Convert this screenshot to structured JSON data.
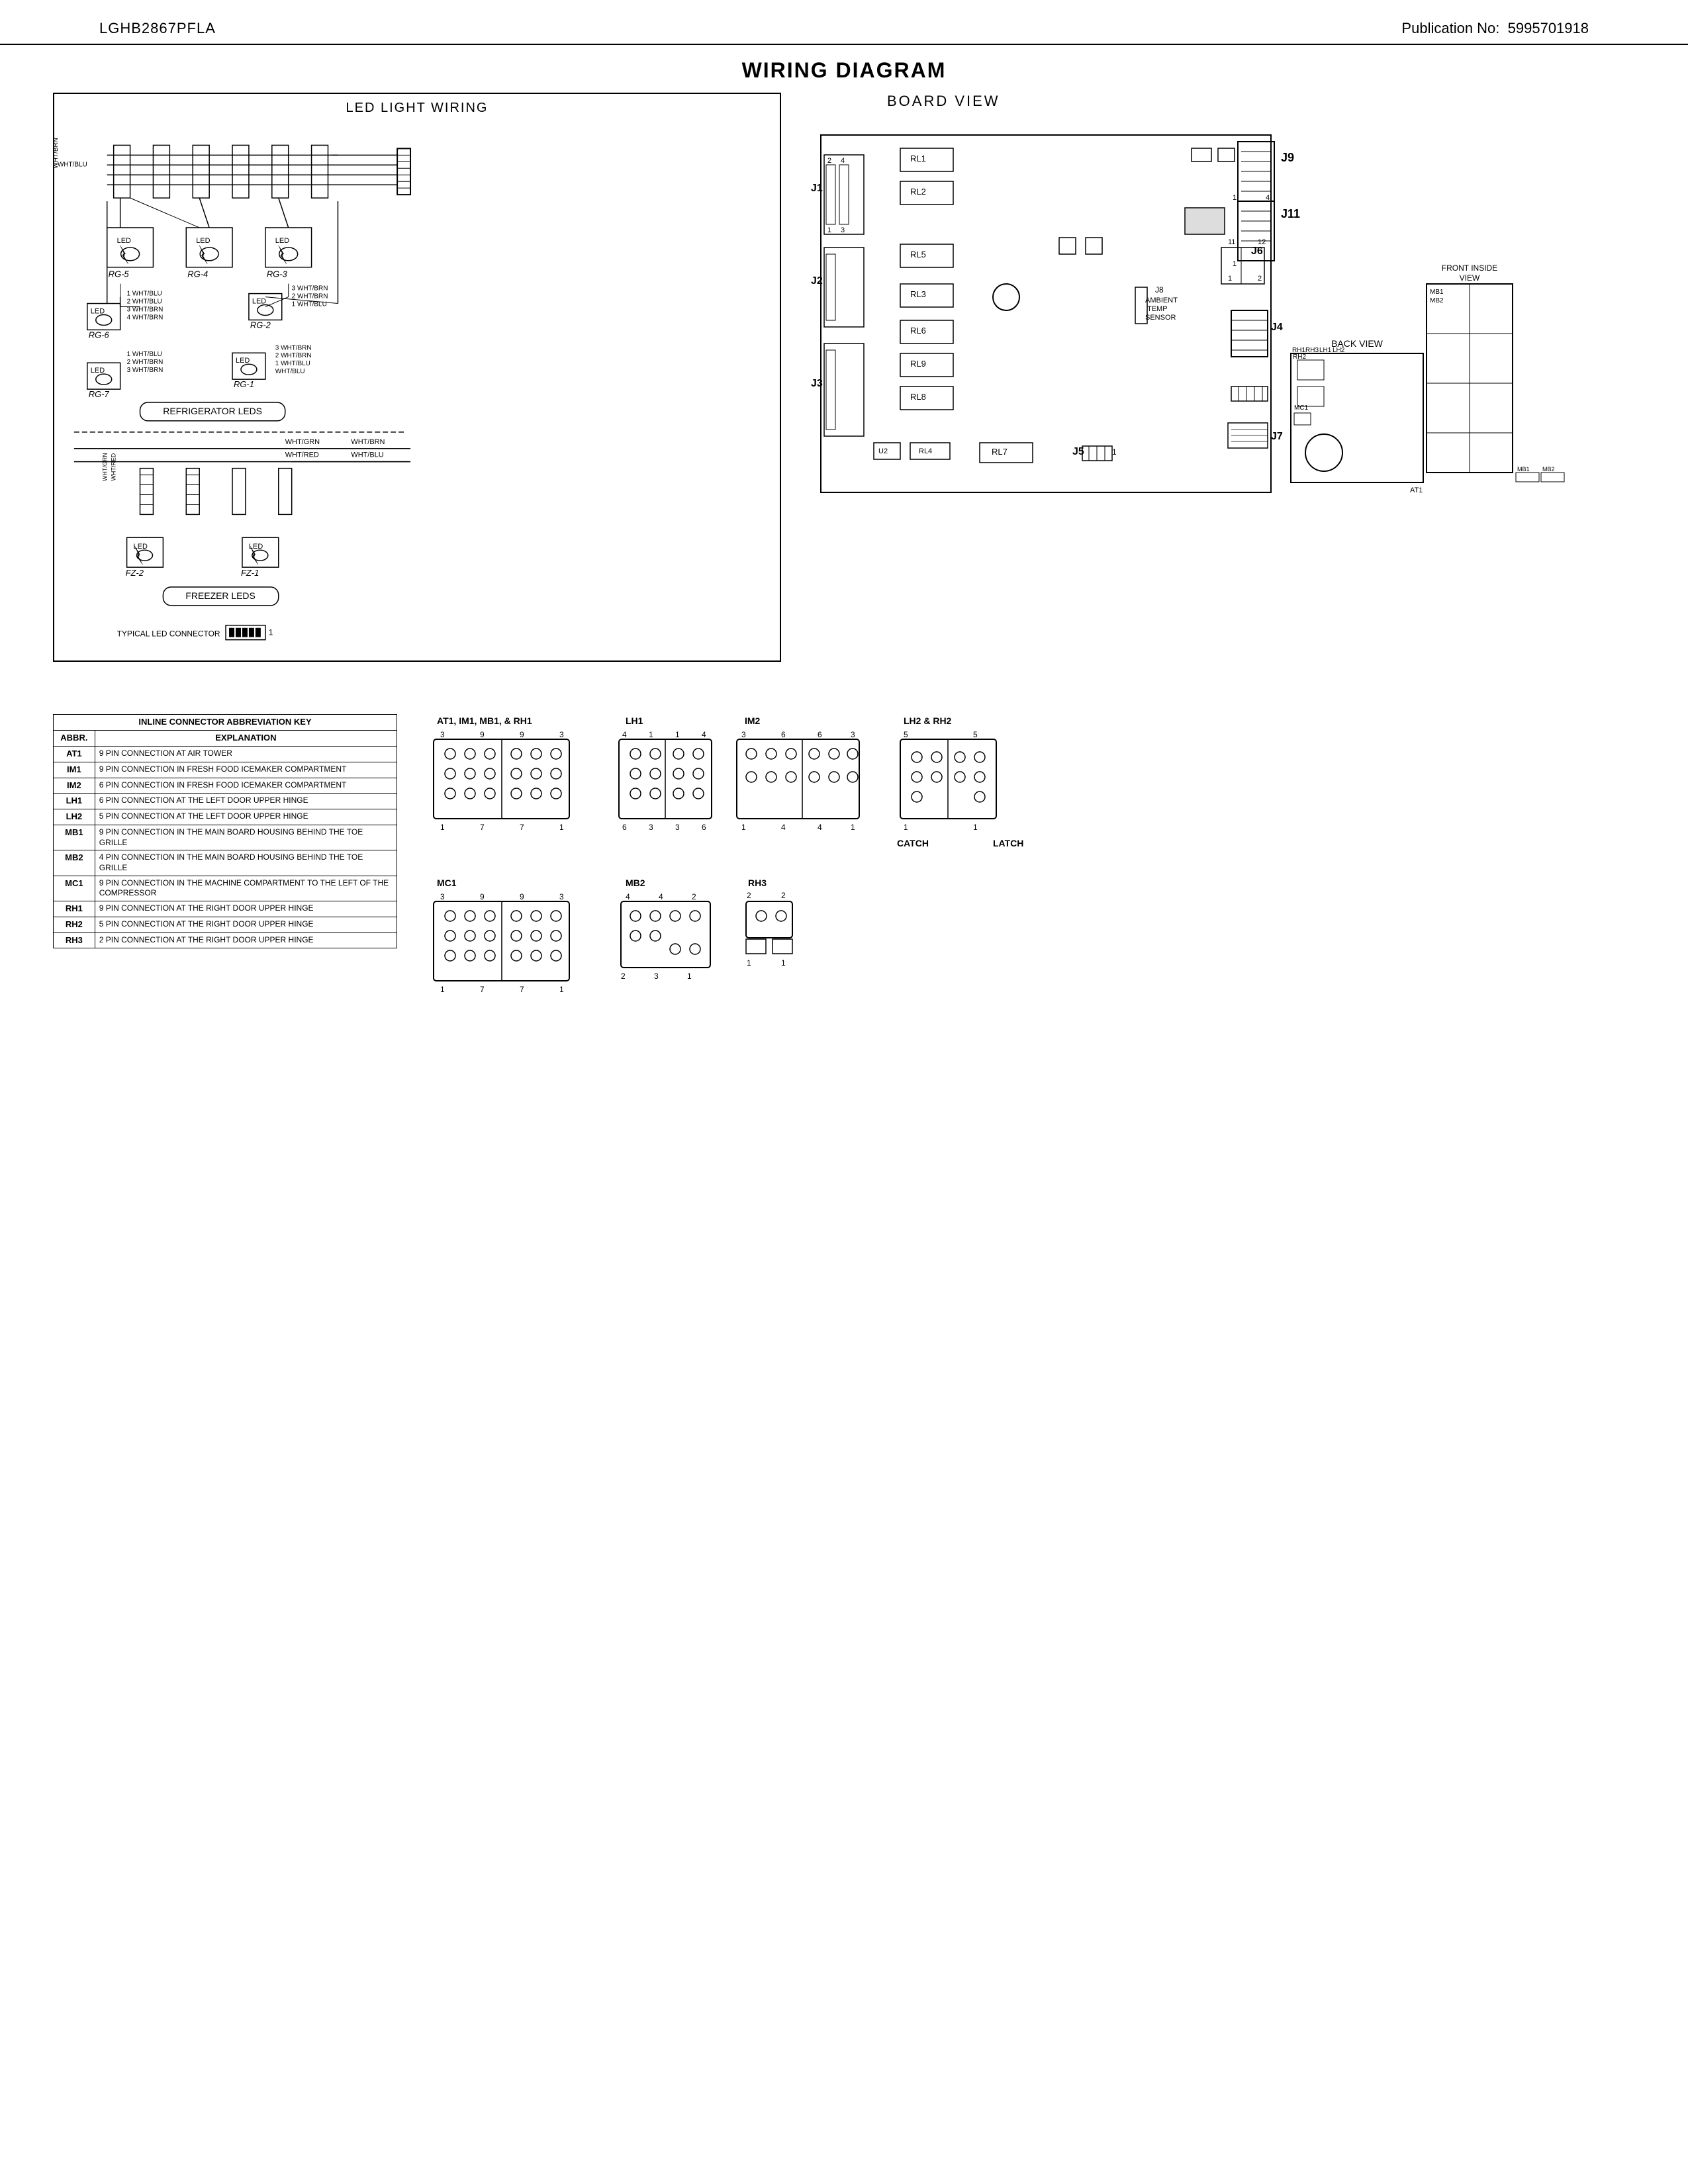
{
  "header": {
    "model": "LGHB2867PFLA",
    "pub_label": "Publication No:",
    "pub_number": "5995701918"
  },
  "page_title": "WIRING DIAGRAM",
  "wiring_section": {
    "title": "LED LIGHT WIRING",
    "led_items": [
      "RG-5",
      "RG-4",
      "RG-3",
      "RG-6",
      "RG-2",
      "RG-7",
      "RG-1"
    ],
    "section_label_ref": "REFRIGERATOR LEDS",
    "freezer_label": "FREEZER LEDS",
    "fz1": "FZ-1",
    "fz2": "FZ-2",
    "typical_label": "TYPICAL LED CONNECTOR"
  },
  "board_view": {
    "title": "BOARD VIEW",
    "connectors": [
      "J1",
      "J2",
      "J3",
      "J4",
      "J5",
      "J6",
      "J7",
      "J9",
      "J11"
    ],
    "relays": [
      "RL1",
      "RL2",
      "RL3",
      "RL4",
      "RL5",
      "RL6",
      "RL7",
      "RL8",
      "RL9"
    ],
    "sensors": [
      "J8",
      "AMBIENT TEMP SENSOR",
      "U2"
    ],
    "back_view_label": "BACK VIEW",
    "front_inside_view_label": "FRONT INSIDE VIEW",
    "refs": [
      "AT1",
      "RH1",
      "RH2",
      "RH3",
      "LH1",
      "LH2",
      "MC1",
      "MB1",
      "MB2"
    ]
  },
  "abbr_table": {
    "title": "INLINE CONNECTOR ABBREVIATION KEY",
    "col1": "ABBR.",
    "col2": "EXPLANATION",
    "rows": [
      {
        "abbr": "AT1",
        "exp": "9 PIN CONNECTION AT AIR TOWER"
      },
      {
        "abbr": "IM1",
        "exp": "9 PIN CONNECTION IN FRESH FOOD ICEMAKER COMPARTMENT"
      },
      {
        "abbr": "IM2",
        "exp": "6 PIN CONNECTION IN FRESH FOOD ICEMAKER COMPARTMENT"
      },
      {
        "abbr": "LH1",
        "exp": "6 PIN CONNECTION AT THE LEFT DOOR UPPER HINGE"
      },
      {
        "abbr": "LH2",
        "exp": "5 PIN CONNECTION AT THE LEFT DOOR UPPER HINGE"
      },
      {
        "abbr": "MB1",
        "exp": "9 PIN CONNECTION IN THE MAIN BOARD HOUSING BEHIND THE TOE GRILLE"
      },
      {
        "abbr": "MB2",
        "exp": "4 PIN CONNECTION IN THE MAIN BOARD HOUSING BEHIND THE TOE GRILLE"
      },
      {
        "abbr": "MC1",
        "exp": "9 PIN CONNECTION IN THE MACHINE COMPARTMENT TO THE LEFT OF THE COMPRESSOR"
      },
      {
        "abbr": "RH1",
        "exp": "9 PIN CONNECTION AT THE RIGHT DOOR UPPER HINGE"
      },
      {
        "abbr": "RH2",
        "exp": "5 PIN CONNECTION AT THE RIGHT DOOR UPPER HINGE"
      },
      {
        "abbr": "RH3",
        "exp": "2 PIN CONNECTION AT THE RIGHT DOOR UPPER HINGE"
      }
    ]
  },
  "connectors": {
    "at1_im1_mb1_rh1": {
      "label": "AT1, IM1, MB1, & RH1",
      "pins": "3-9-9-3"
    },
    "lh1": {
      "label": "LH1",
      "pins": "4-1-4"
    },
    "im2": {
      "label": "IM2",
      "pins": "3-6-6-3"
    },
    "lh2_rh2": {
      "label": "LH2 & RH2",
      "pins": "5-5"
    },
    "catch_label": "CATCH",
    "latch_label": "LATCH",
    "mc1": {
      "label": "MC1",
      "pins": "3-9-9-3"
    },
    "mb2": {
      "label": "MB2",
      "pins": "4-4-2"
    },
    "rh3": {
      "label": "RH3",
      "pins": "2"
    }
  }
}
